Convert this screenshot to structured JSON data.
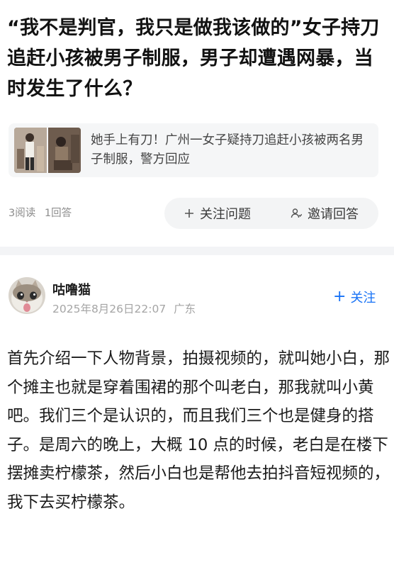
{
  "question": {
    "title": "“我不是判官，我只是做我该做的”女子持刀追赶小孩被男子制服，男子却遭遇网暴，当时发生了什么？"
  },
  "related": {
    "text": "她手上有刀！广州一女子疑持刀追赶小孩被两名男子制服，警方回应"
  },
  "meta": {
    "views": "3阅读",
    "answers": "1回答"
  },
  "actions": {
    "follow_label": "关注问题",
    "invite_label": "邀请回答"
  },
  "author": {
    "name": "咕噜猫",
    "datetime": "2025年8月26日22:07",
    "location": "广东",
    "follow_label": "关注"
  },
  "answer": {
    "text": "首先介绍一下人物背景，拍摄视频的，就叫她小白，那个摊主也就是穿着围裙的那个叫老白，那我就叫小黄吧。我们三个是认识的，而且我们三个也是健身的搭子。是周六的晚上，大概 10 点的时候，老白是在楼下摆摊卖柠檬茶，然后小白也是帮他去拍抖音短视频的，我下去买柠檬茶。"
  },
  "colors": {
    "accent": "#1772f6",
    "card_bg": "#f5f6f7",
    "muted_text": "#8d8d8d"
  }
}
